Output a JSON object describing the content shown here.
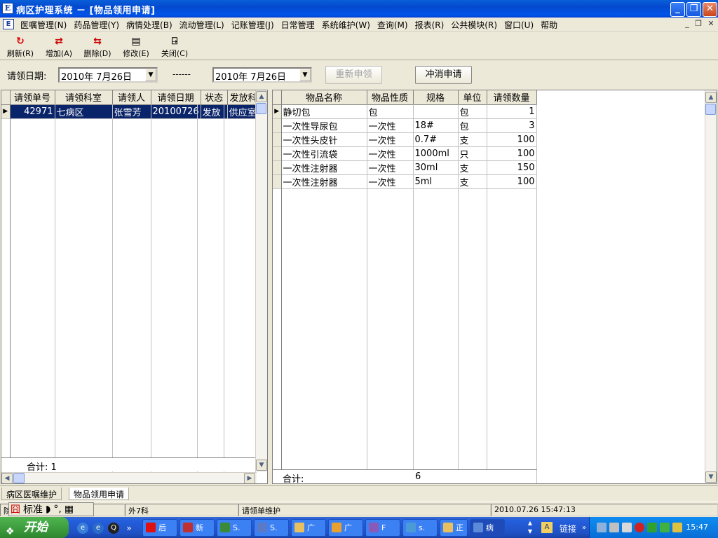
{
  "window": {
    "title": "病区护理系统 － [物品领用申请]"
  },
  "menu": [
    "医嘱管理(N)",
    "药品管理(Y)",
    "病情处理(B)",
    "流动管理(L)",
    "记账管理(J)",
    "日常管理",
    "系统维护(W)",
    "查询(M)",
    "报表(R)",
    "公共模块(R)",
    "窗口(U)",
    "帮助"
  ],
  "toolbar": {
    "refresh": "刷新(R)",
    "add": "增加(A)",
    "delete": "删除(D)",
    "edit": "修改(E)",
    "close": "关闭(C)"
  },
  "filter": {
    "label": "请领日期:",
    "date_from": "2010年 7月26日",
    "separator": "------",
    "date_to": "2010年 7月26日",
    "reapply": "重新申领",
    "cancel_apply": "冲消申请"
  },
  "left_grid": {
    "headers": [
      "请领单号",
      "请领科室",
      "请领人",
      "请领日期",
      "状态",
      "发放科"
    ],
    "rows": [
      [
        "42971",
        "七病区",
        "张雪芳",
        "20100726",
        "发放",
        "供应室"
      ]
    ],
    "footer": "合计: 1"
  },
  "right_grid": {
    "headers": [
      "物品名称",
      "物品性质",
      "规格",
      "单位",
      "请领数量"
    ],
    "rows": [
      [
        "静切包",
        "包",
        "",
        "包",
        "1"
      ],
      [
        "一次性导尿包",
        "一次性",
        "18#",
        "包",
        "3"
      ],
      [
        "一次性头皮针",
        "一次性",
        "0.7#",
        "支",
        "100"
      ],
      [
        "一次性引流袋",
        "一次性",
        "1000ml",
        "只",
        "100"
      ],
      [
        "一次性注射器",
        "一次性",
        "30ml",
        "支",
        "150"
      ],
      [
        "一次性注射器",
        "一次性",
        "5ml",
        "支",
        "100"
      ]
    ],
    "footer_label": "合计:",
    "footer_count": "6"
  },
  "tabs": [
    "病区医嘱维护",
    "物品领用申请"
  ],
  "status": {
    "p1": "院",
    "p2": "外7科",
    "p3": "请领单维护",
    "p4": "2010.07.26 15:47:13",
    "ime_mode": "标准"
  },
  "taskbar": {
    "start": "开始",
    "tasks": [
      "后",
      "新",
      "S.",
      "S.",
      "广",
      "广",
      "F",
      "s.",
      "正",
      "病"
    ],
    "links": "链接",
    "clock": "15:47"
  },
  "colors": {
    "selected_row": "#0a246a",
    "titlebar": "#0349cf",
    "taskbar": "#245edb",
    "start": "#3c9a3c"
  }
}
